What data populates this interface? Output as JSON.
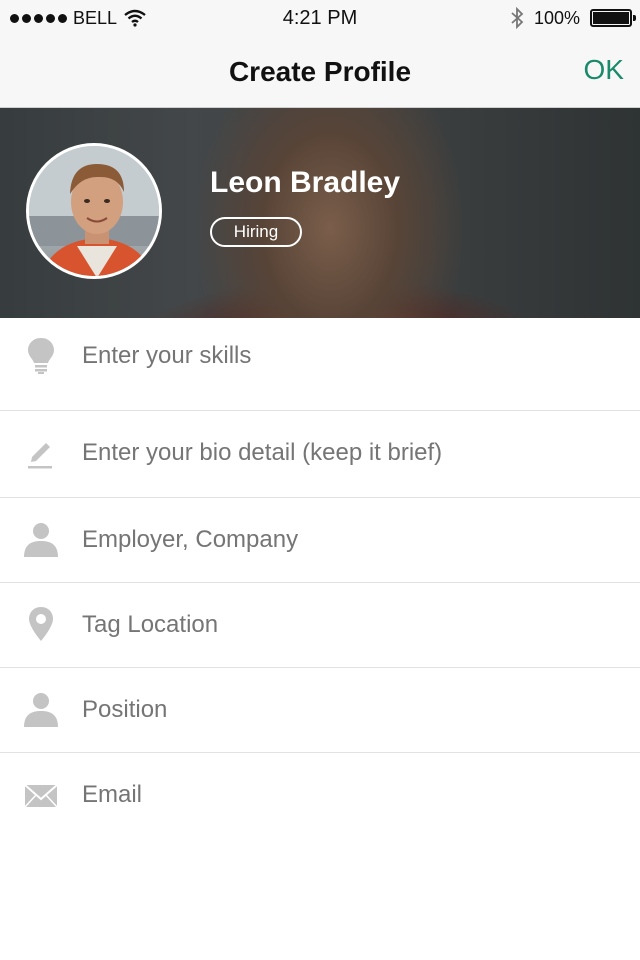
{
  "status_bar": {
    "carrier": "BELL",
    "time": "4:21 PM",
    "battery": "100%",
    "icons": [
      "signal-dots-icon",
      "wifi-icon",
      "bluetooth-icon",
      "battery-icon"
    ]
  },
  "nav": {
    "title": "Create Profile",
    "ok_label": "OK",
    "accent_color": "#1a8a6a"
  },
  "profile": {
    "name": "Leon Bradley",
    "badge": "Hiring"
  },
  "form": {
    "fields": [
      {
        "icon": "lightbulb-icon",
        "placeholder": "Enter your skills",
        "value": ""
      },
      {
        "icon": "pencil-icon",
        "placeholder": "Enter your bio detail (keep it brief)",
        "value": ""
      },
      {
        "icon": "person-icon",
        "placeholder": "Employer, Company",
        "value": ""
      },
      {
        "icon": "location-pin-icon",
        "placeholder": "Tag Location",
        "value": ""
      },
      {
        "icon": "person-icon",
        "placeholder": "Position",
        "value": ""
      },
      {
        "icon": "envelope-icon",
        "placeholder": "Email",
        "value": ""
      }
    ]
  }
}
